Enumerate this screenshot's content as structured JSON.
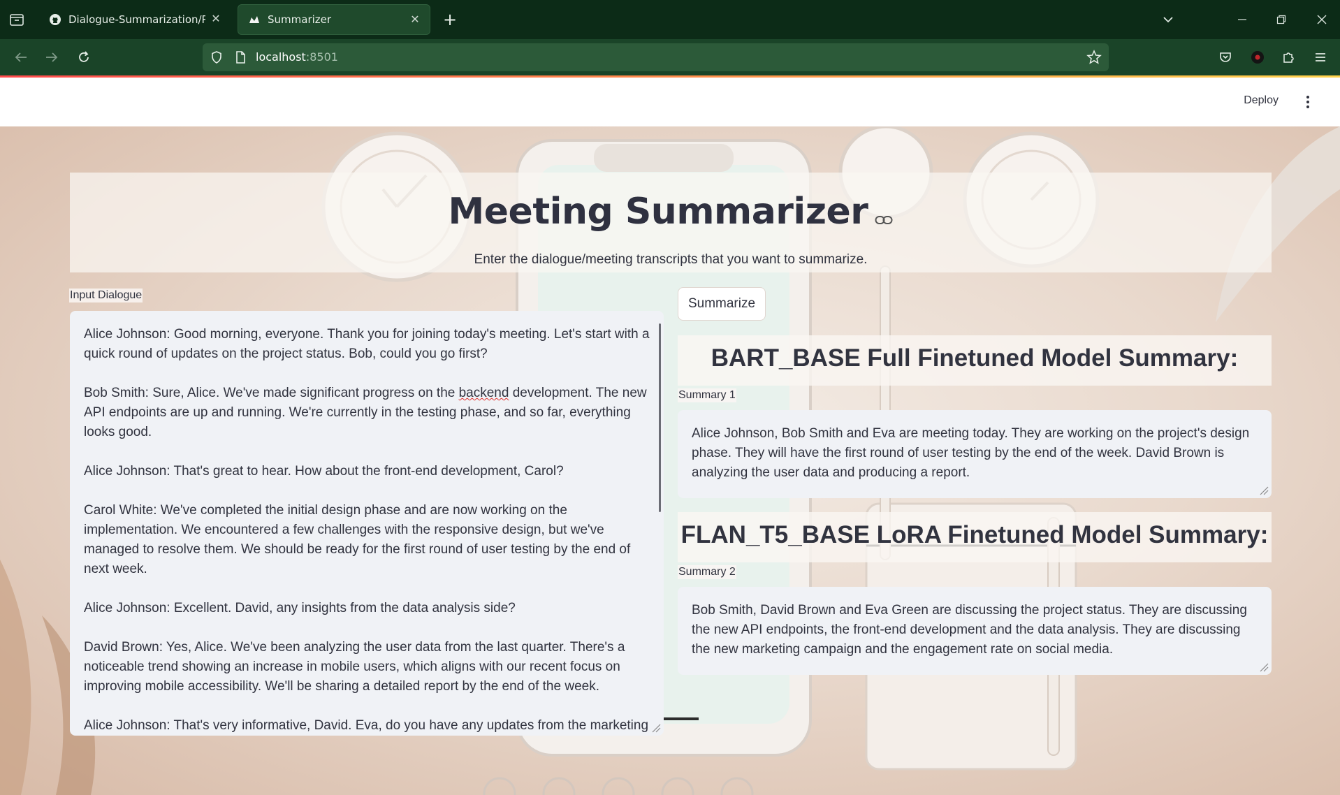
{
  "browser": {
    "tabs": [
      {
        "title": "Dialogue-Summarization/READ",
        "favicon": "github-icon",
        "active": false
      },
      {
        "title": "Summarizer",
        "favicon": "streamlit-icon",
        "active": true
      }
    ],
    "url_host": "localhost",
    "url_port": ":8501"
  },
  "header": {
    "deploy_label": "Deploy"
  },
  "app": {
    "title": "Meeting Summarizer",
    "subtitle": "Enter the dialogue/meeting transcripts that you want to summarize.",
    "input_label": "Input Dialogue",
    "input_text_before_typo": "Alice Johnson: Good morning, everyone. Thank you for joining today's meeting. Let's start with a quick round of updates on the project status. Bob, could you go first?\n\nBob Smith: Sure, Alice. We've made significant progress on the ",
    "input_typo_word": "backend",
    "input_text_after_typo": " development. The new API endpoints are up and running. We're currently in the testing phase, and so far, everything looks good.\n\nAlice Johnson: That's great to hear. How about the front-end development, Carol?\n\nCarol White: We've completed the initial design phase and are now working on the implementation. We encountered a few challenges with the responsive design, but we've managed to resolve them. We should be ready for the first round of user testing by the end of next week.\n\nAlice Johnson: Excellent. David, any insights from the data analysis side?\n\nDavid Brown: Yes, Alice. We've been analyzing the user data from the last quarter. There's a noticeable trend showing an increase in mobile users, which aligns with our recent focus on improving mobile accessibility. We'll be sharing a detailed report by the end of the week.\n\nAlice Johnson: That's very informative, David. Eva, do you have any updates from the marketing team?",
    "summarize_label": "Summarize",
    "summary1": {
      "heading": "BART_BASE Full Finetuned Model Summary:",
      "label": "Summary 1",
      "text": "Alice Johnson, Bob Smith and Eva are meeting today. They are working on the project's design phase. They will have the first round of user testing by the end of the week. David Brown is analyzing the user data and producing a report."
    },
    "summary2": {
      "heading": "FLAN_T5_BASE LoRA Finetuned Model Summary:",
      "label": "Summary 2",
      "text": "Bob Smith, David Brown and Eva Green are discussing the project status. They are discussing the new API endpoints, the front-end development and the data analysis. They are discussing the new marketing campaign and the engagement rate on social media."
    }
  },
  "colors": {
    "chrome_dark": "#0c2b17",
    "chrome_nav": "#1a4428",
    "text": "#31333f",
    "input_bg": "#f0f2f6"
  }
}
